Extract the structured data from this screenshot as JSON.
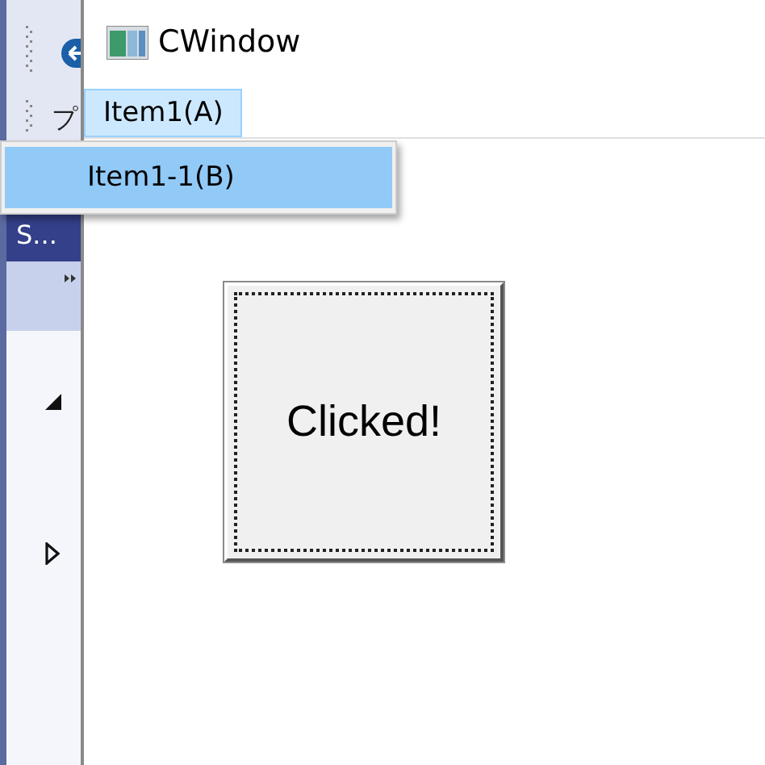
{
  "side_panel": {
    "fragment": "プ",
    "header": "S..."
  },
  "window": {
    "title": "CWindow"
  },
  "menu": [
    {
      "label": "Item1(A)",
      "selected": true
    }
  ],
  "dropdown": [
    {
      "label": "Item1-1(B)",
      "selected": true
    }
  ],
  "button": {
    "label": "Clicked!",
    "focused": true
  }
}
